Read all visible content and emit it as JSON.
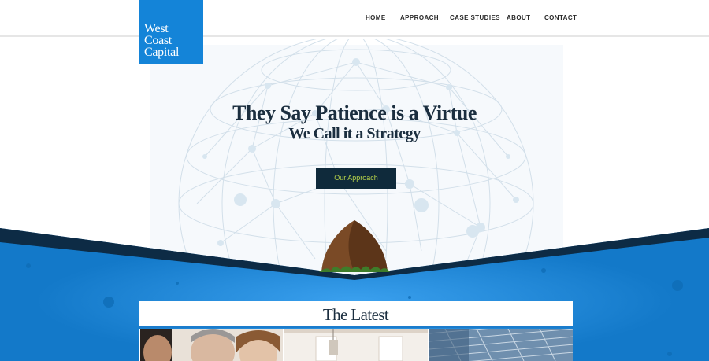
{
  "brand": {
    "logo_lines": [
      "West",
      "Coast",
      "Capital"
    ],
    "logo_color": "#1484d8"
  },
  "nav": {
    "items": [
      "HOME",
      "APPROACH",
      "CASE STUDIES",
      "ABOUT",
      "CONTACT"
    ]
  },
  "hero": {
    "title": "They Say Patience is a Virtue",
    "subtitle": "We Call it a Strategy",
    "cta_label": "Our Approach",
    "cta_color": "#0f2a3b",
    "cta_text_color": "#b8d44a"
  },
  "latest": {
    "title": "The Latest",
    "cards": [
      {
        "image": "people-photo"
      },
      {
        "image": "interior-photo"
      },
      {
        "image": "glass-building-photo"
      }
    ]
  },
  "colors": {
    "primary_blue": "#1484d8",
    "dark_navy": "#0d2b45",
    "text_dark": "#1b2e3f"
  }
}
